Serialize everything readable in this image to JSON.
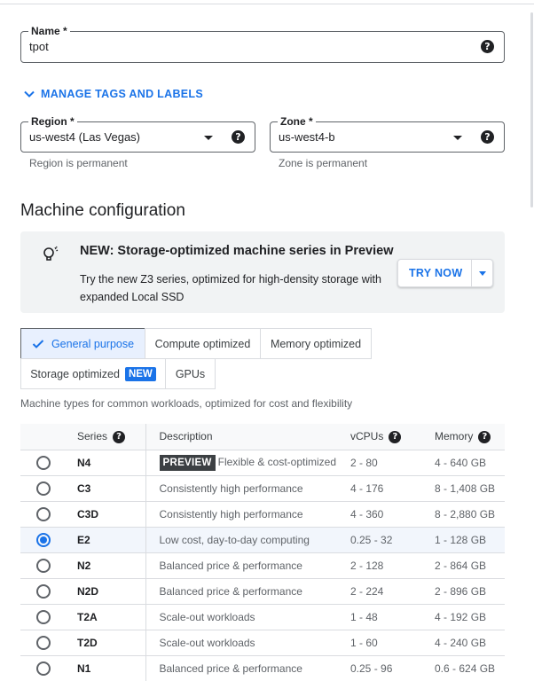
{
  "name_field": {
    "label": "Name *",
    "value": "tpot"
  },
  "manage_tags": {
    "label": "MANAGE TAGS AND LABELS"
  },
  "region": {
    "label": "Region *",
    "value": "us-west4 (Las Vegas)",
    "hint": "Region is permanent"
  },
  "zone": {
    "label": "Zone *",
    "value": "us-west4-b",
    "hint": "Zone is permanent"
  },
  "machine_config": {
    "title": "Machine configuration",
    "banner": {
      "title": "NEW: Storage-optimized machine series in Preview",
      "description": "Try the new Z3 series, optimized for high-density storage with expanded Local SSD",
      "button": "TRY NOW"
    },
    "tabs": [
      {
        "label": "General purpose",
        "active": true
      },
      {
        "label": "Compute optimized"
      },
      {
        "label": "Memory optimized"
      },
      {
        "label": "Storage optimized",
        "badge": "NEW"
      },
      {
        "label": "GPUs"
      }
    ],
    "caption": "Machine types for common workloads, optimized for cost and flexibility",
    "table": {
      "headers": [
        "Series",
        "Description",
        "vCPUs",
        "Memory"
      ],
      "rows": [
        {
          "series": "N4",
          "badge": "PREVIEW",
          "description": "Flexible & cost-optimized",
          "vcpus": "2 - 80",
          "memory": "4 - 640 GB"
        },
        {
          "series": "C3",
          "description": "Consistently high performance",
          "vcpus": "4 - 176",
          "memory": "8 - 1,408 GB"
        },
        {
          "series": "C3D",
          "description": "Consistently high performance",
          "vcpus": "4 - 360",
          "memory": "8 - 2,880 GB"
        },
        {
          "series": "E2",
          "description": "Low cost, day-to-day computing",
          "vcpus": "0.25 - 32",
          "memory": "1 - 128 GB",
          "selected": true
        },
        {
          "series": "N2",
          "description": "Balanced price & performance",
          "vcpus": "2 - 128",
          "memory": "2 - 864 GB"
        },
        {
          "series": "N2D",
          "description": "Balanced price & performance",
          "vcpus": "2 - 224",
          "memory": "2 - 896 GB"
        },
        {
          "series": "T2A",
          "description": "Scale-out workloads",
          "vcpus": "1 - 48",
          "memory": "4 - 192 GB"
        },
        {
          "series": "T2D",
          "description": "Scale-out workloads",
          "vcpus": "1 - 60",
          "memory": "4 - 240 GB"
        },
        {
          "series": "N1",
          "description": "Balanced price & performance",
          "vcpus": "0.25 - 96",
          "memory": "0.6 - 624 GB"
        }
      ]
    }
  },
  "colors": {
    "accent": "#1a73e8",
    "text": "#202124",
    "muted": "#5f6368",
    "border": "#dadce0"
  }
}
